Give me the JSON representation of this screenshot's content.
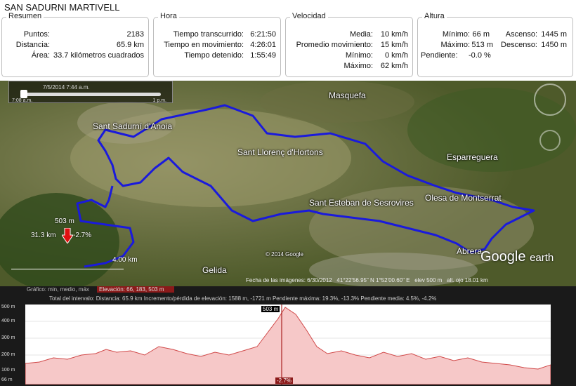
{
  "title": "SAN SADURNI MARTIVELL",
  "resumen": {
    "title": "Resumen",
    "rows": [
      {
        "label": "Puntos:",
        "value": "2183"
      },
      {
        "label": "Distancia:",
        "value": "65.9 km"
      },
      {
        "label": "Área:",
        "value": "33.7 kilómetros cuadrados"
      }
    ]
  },
  "hora": {
    "title": "Hora",
    "rows": [
      {
        "label": "Tiempo transcurrido:",
        "value": "6:21:50"
      },
      {
        "label": "Tiempo en movimiento:",
        "value": "4:26:01"
      },
      {
        "label": "Tiempo detenido:",
        "value": "1:55:49"
      }
    ]
  },
  "velocidad": {
    "title": "Velocidad",
    "rows": [
      {
        "label": "Media:",
        "value": "10 km/h"
      },
      {
        "label": "Promedio movimiento:",
        "value": "15 km/h"
      },
      {
        "label": "Mínimo:",
        "value": "0 km/h"
      },
      {
        "label": "Máximo:",
        "value": "62 km/h"
      }
    ]
  },
  "altura": {
    "title": "Altura",
    "minimo_label": "Mínimo:",
    "minimo": "66 m",
    "ascenso_label": "Ascenso:",
    "ascenso": "1445 m",
    "maximo_label": "Máximo:",
    "maximo": "513 m",
    "descenso_label": "Descenso:",
    "descenso": "1450 m",
    "pendiente_label": "Pendiente:",
    "pendiente": "-0.0 %"
  },
  "map": {
    "places": [
      "Masquefa",
      "Sant Sadurní d'Anoia",
      "Sant Llorenç d'Hortons",
      "Esparreguera",
      "Sant Esteban de Sesrovires",
      "Olesa de Montserrat",
      "Abrera",
      "Gelida"
    ],
    "copyright": "© 2014 Google",
    "imagery_date": "Fecha de las imágenes: 6/30/2012",
    "coords": "41°22'56.95\" N  1°52'00.60\" E",
    "elev": "elev  500 m",
    "eye_alt": "alt. ojo  18.01 km",
    "brand": "Google",
    "brand_suffix": "earth",
    "tour_text": "7/5/2014  7:44 a.m.",
    "tour_left": "7:08 a.m.",
    "tour_right": "1 p.m.",
    "ann_elev": "503 m",
    "ann_km": "31.3 km",
    "ann_grade": "-2.7%",
    "ann_scale": "4.00 km"
  },
  "profile": {
    "header": "Gráfico: min, medio, máx",
    "elev_tag": "Elevación: 66, 183, 503 m",
    "stats": "Total del intervalo: Distancia: 65.9 km    Incremento/pérdida de elevación: 1588 m, -1721 m    Pendiente máxima: 19.3%, -13.3%    Pendiente media: 4.5%, -4.2%",
    "y_labels": [
      "500 m",
      "400 m",
      "300 m",
      "200 m",
      "100 m",
      "66 m"
    ],
    "peak_tag": "503 m",
    "bottom_tag": "-2.7%",
    "colors": {
      "fill": "#f6c8c8",
      "line": "#d04848"
    }
  }
}
